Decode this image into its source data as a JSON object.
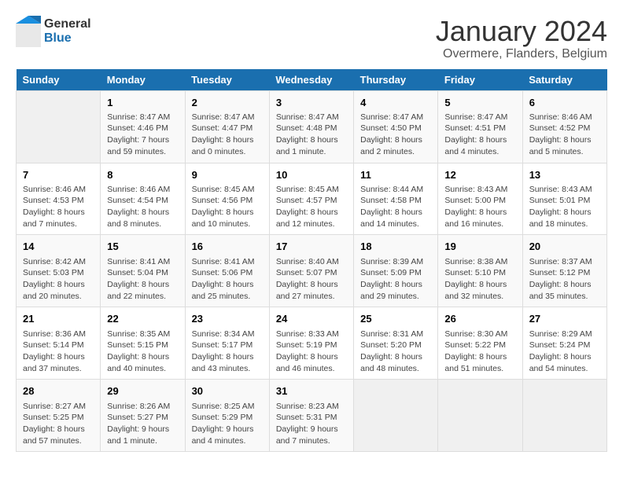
{
  "header": {
    "logo_general": "General",
    "logo_blue": "Blue",
    "title": "January 2024",
    "subtitle": "Overmere, Flanders, Belgium"
  },
  "days_of_week": [
    "Sunday",
    "Monday",
    "Tuesday",
    "Wednesday",
    "Thursday",
    "Friday",
    "Saturday"
  ],
  "weeks": [
    [
      {
        "day": "",
        "empty": true
      },
      {
        "day": "1",
        "sunrise": "Sunrise: 8:47 AM",
        "sunset": "Sunset: 4:46 PM",
        "daylight": "Daylight: 7 hours and 59 minutes."
      },
      {
        "day": "2",
        "sunrise": "Sunrise: 8:47 AM",
        "sunset": "Sunset: 4:47 PM",
        "daylight": "Daylight: 8 hours and 0 minutes."
      },
      {
        "day": "3",
        "sunrise": "Sunrise: 8:47 AM",
        "sunset": "Sunset: 4:48 PM",
        "daylight": "Daylight: 8 hours and 1 minute."
      },
      {
        "day": "4",
        "sunrise": "Sunrise: 8:47 AM",
        "sunset": "Sunset: 4:50 PM",
        "daylight": "Daylight: 8 hours and 2 minutes."
      },
      {
        "day": "5",
        "sunrise": "Sunrise: 8:47 AM",
        "sunset": "Sunset: 4:51 PM",
        "daylight": "Daylight: 8 hours and 4 minutes."
      },
      {
        "day": "6",
        "sunrise": "Sunrise: 8:46 AM",
        "sunset": "Sunset: 4:52 PM",
        "daylight": "Daylight: 8 hours and 5 minutes."
      }
    ],
    [
      {
        "day": "7",
        "sunrise": "Sunrise: 8:46 AM",
        "sunset": "Sunset: 4:53 PM",
        "daylight": "Daylight: 8 hours and 7 minutes."
      },
      {
        "day": "8",
        "sunrise": "Sunrise: 8:46 AM",
        "sunset": "Sunset: 4:54 PM",
        "daylight": "Daylight: 8 hours and 8 minutes."
      },
      {
        "day": "9",
        "sunrise": "Sunrise: 8:45 AM",
        "sunset": "Sunset: 4:56 PM",
        "daylight": "Daylight: 8 hours and 10 minutes."
      },
      {
        "day": "10",
        "sunrise": "Sunrise: 8:45 AM",
        "sunset": "Sunset: 4:57 PM",
        "daylight": "Daylight: 8 hours and 12 minutes."
      },
      {
        "day": "11",
        "sunrise": "Sunrise: 8:44 AM",
        "sunset": "Sunset: 4:58 PM",
        "daylight": "Daylight: 8 hours and 14 minutes."
      },
      {
        "day": "12",
        "sunrise": "Sunrise: 8:43 AM",
        "sunset": "Sunset: 5:00 PM",
        "daylight": "Daylight: 8 hours and 16 minutes."
      },
      {
        "day": "13",
        "sunrise": "Sunrise: 8:43 AM",
        "sunset": "Sunset: 5:01 PM",
        "daylight": "Daylight: 8 hours and 18 minutes."
      }
    ],
    [
      {
        "day": "14",
        "sunrise": "Sunrise: 8:42 AM",
        "sunset": "Sunset: 5:03 PM",
        "daylight": "Daylight: 8 hours and 20 minutes."
      },
      {
        "day": "15",
        "sunrise": "Sunrise: 8:41 AM",
        "sunset": "Sunset: 5:04 PM",
        "daylight": "Daylight: 8 hours and 22 minutes."
      },
      {
        "day": "16",
        "sunrise": "Sunrise: 8:41 AM",
        "sunset": "Sunset: 5:06 PM",
        "daylight": "Daylight: 8 hours and 25 minutes."
      },
      {
        "day": "17",
        "sunrise": "Sunrise: 8:40 AM",
        "sunset": "Sunset: 5:07 PM",
        "daylight": "Daylight: 8 hours and 27 minutes."
      },
      {
        "day": "18",
        "sunrise": "Sunrise: 8:39 AM",
        "sunset": "Sunset: 5:09 PM",
        "daylight": "Daylight: 8 hours and 29 minutes."
      },
      {
        "day": "19",
        "sunrise": "Sunrise: 8:38 AM",
        "sunset": "Sunset: 5:10 PM",
        "daylight": "Daylight: 8 hours and 32 minutes."
      },
      {
        "day": "20",
        "sunrise": "Sunrise: 8:37 AM",
        "sunset": "Sunset: 5:12 PM",
        "daylight": "Daylight: 8 hours and 35 minutes."
      }
    ],
    [
      {
        "day": "21",
        "sunrise": "Sunrise: 8:36 AM",
        "sunset": "Sunset: 5:14 PM",
        "daylight": "Daylight: 8 hours and 37 minutes."
      },
      {
        "day": "22",
        "sunrise": "Sunrise: 8:35 AM",
        "sunset": "Sunset: 5:15 PM",
        "daylight": "Daylight: 8 hours and 40 minutes."
      },
      {
        "day": "23",
        "sunrise": "Sunrise: 8:34 AM",
        "sunset": "Sunset: 5:17 PM",
        "daylight": "Daylight: 8 hours and 43 minutes."
      },
      {
        "day": "24",
        "sunrise": "Sunrise: 8:33 AM",
        "sunset": "Sunset: 5:19 PM",
        "daylight": "Daylight: 8 hours and 46 minutes."
      },
      {
        "day": "25",
        "sunrise": "Sunrise: 8:31 AM",
        "sunset": "Sunset: 5:20 PM",
        "daylight": "Daylight: 8 hours and 48 minutes."
      },
      {
        "day": "26",
        "sunrise": "Sunrise: 8:30 AM",
        "sunset": "Sunset: 5:22 PM",
        "daylight": "Daylight: 8 hours and 51 minutes."
      },
      {
        "day": "27",
        "sunrise": "Sunrise: 8:29 AM",
        "sunset": "Sunset: 5:24 PM",
        "daylight": "Daylight: 8 hours and 54 minutes."
      }
    ],
    [
      {
        "day": "28",
        "sunrise": "Sunrise: 8:27 AM",
        "sunset": "Sunset: 5:25 PM",
        "daylight": "Daylight: 8 hours and 57 minutes."
      },
      {
        "day": "29",
        "sunrise": "Sunrise: 8:26 AM",
        "sunset": "Sunset: 5:27 PM",
        "daylight": "Daylight: 9 hours and 1 minute."
      },
      {
        "day": "30",
        "sunrise": "Sunrise: 8:25 AM",
        "sunset": "Sunset: 5:29 PM",
        "daylight": "Daylight: 9 hours and 4 minutes."
      },
      {
        "day": "31",
        "sunrise": "Sunrise: 8:23 AM",
        "sunset": "Sunset: 5:31 PM",
        "daylight": "Daylight: 9 hours and 7 minutes."
      },
      {
        "day": "",
        "empty": true
      },
      {
        "day": "",
        "empty": true
      },
      {
        "day": "",
        "empty": true
      }
    ]
  ]
}
